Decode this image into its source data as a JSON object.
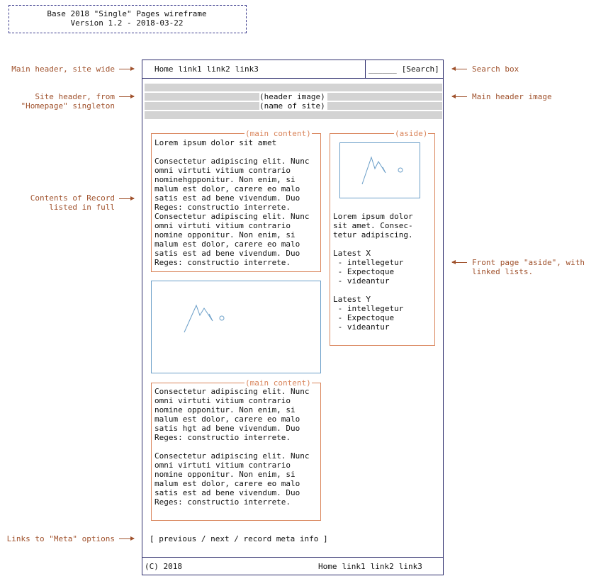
{
  "title": {
    "line1": "Base 2018 \"Single\" Pages wireframe",
    "line2": "Version 1.2 - 2018-03-22"
  },
  "annotations": {
    "main_header": "Main header, site wide",
    "site_header": "Site header, from\n\"Homepage\" singleton",
    "contents": "Contents of Record\nlisted in full",
    "meta_links": "Links to \"Meta\" options",
    "search_box": "Search box",
    "main_header_image": "Main header image",
    "front_aside": "Front page \"aside\", with\nlinked lists."
  },
  "header": {
    "nav": [
      "Home",
      "link1",
      "link2",
      "link3"
    ],
    "search_field": "______",
    "search_button": "[Search]"
  },
  "site_header": {
    "image_label": "(header image)",
    "name_label": "(name of site)"
  },
  "main_content_1": {
    "legend": "(main content)",
    "text": "Lorem ipsum dolor sit amet\n\nConsectetur adipiscing elit. Nunc\nomni virtuti vitium contrario\nnominehgpponitur. Non enim, si\nmalum est dolor, carere eo malo\nsatis est ad bene vivendum. Duo\nReges: constructio interrete.\nConsectetur adipiscing elit. Nunc\nomni virtuti vitium contrario\nnomine opponitur. Non enim, si\nmalum est dolor, carere eo malo\nsatis est ad bene vivendum. Duo\nReges: constructio interrete."
  },
  "aside": {
    "legend": "(aside)",
    "text": "Lorem ipsum dolor\nsit amet. Consec-\ntetur adipiscing.",
    "list_x": {
      "title": "Latest X",
      "items": [
        "intellegetur",
        "Expectoque",
        "videantur"
      ]
    },
    "list_y": {
      "title": "Latest Y",
      "items": [
        "intellegetur",
        "Expectoque",
        "videantur"
      ]
    }
  },
  "main_content_2": {
    "legend": "(main content)",
    "text": "Consectetur adipiscing elit. Nunc\nomni virtuti vitium contrario\nnomine opponitur. Non enim, si\nmalum est dolor, carere eo malo\nsatis hgt ad bene vivendum. Duo\nReges: constructio interrete.\n\nConsectetur adipiscing elit. Nunc\nomni virtuti vitium contrario\nnomine opponitur. Non enim, si\nmalum est dolor, carere eo malo\nsatis est ad bene vivendum. Duo\nReges: constructio interrete."
  },
  "meta_links": "[ previous / next / record meta info ]",
  "footer": {
    "copyright": "(C) 2018",
    "nav": [
      "Home",
      "link1",
      "link2",
      "link3"
    ]
  },
  "colors": {
    "frame": "#2b2b6b",
    "annotation": "#a0522d",
    "content_box": "#d9845a",
    "image_box": "#6a9ec8",
    "hatch": "#d3d3d3"
  }
}
